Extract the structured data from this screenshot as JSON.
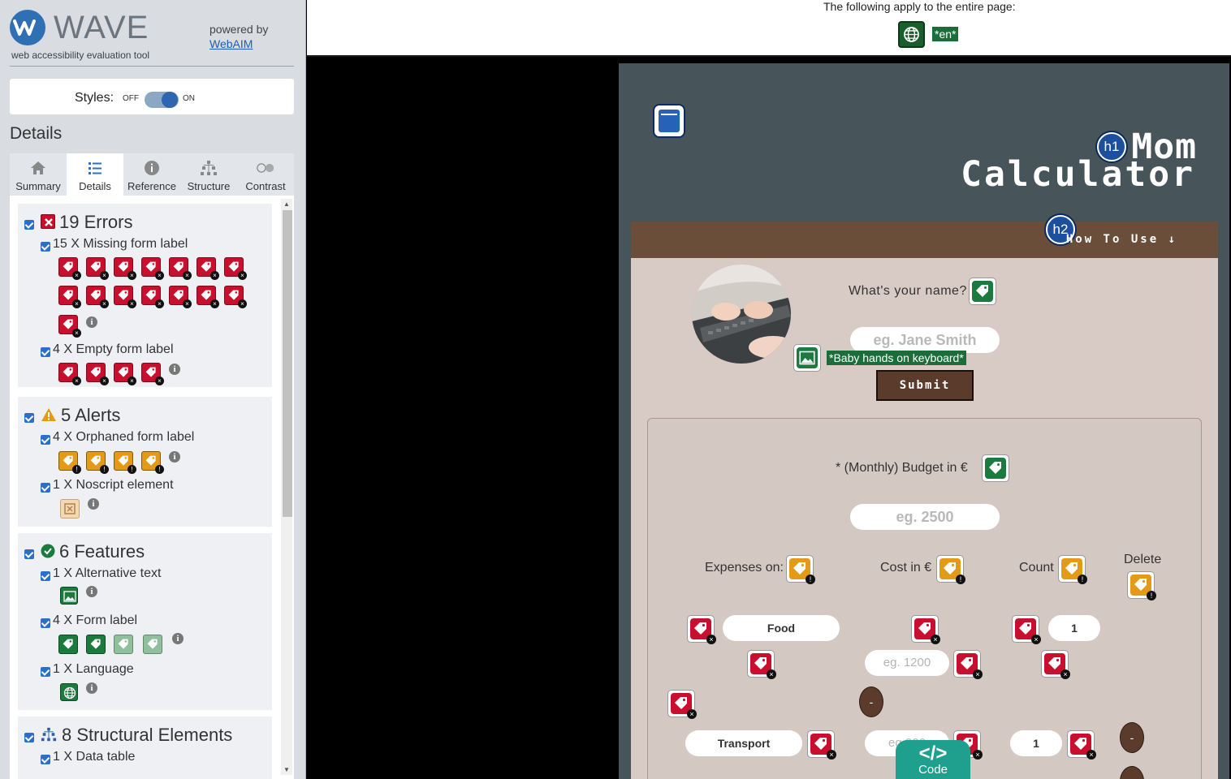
{
  "wave": {
    "brand": "WAVE",
    "subtitle": "web accessibility evaluation tool",
    "powered_by": "powered by",
    "webaim": "WebAIM",
    "styles_label": "Styles:",
    "toggle_off": "OFF",
    "toggle_on": "ON",
    "details_heading": "Details",
    "tabs": [
      {
        "label": "Summary",
        "icon": "home-icon"
      },
      {
        "label": "Details",
        "icon": "list-icon"
      },
      {
        "label": "Reference",
        "icon": "info-icon"
      },
      {
        "label": "Structure",
        "icon": "structure-icon"
      },
      {
        "label": "Contrast",
        "icon": "contrast-icon"
      }
    ],
    "errors": {
      "title": "19 Errors",
      "missing_label": "15 X Missing form label",
      "empty_label": "4 X Empty form label"
    },
    "alerts": {
      "title": "5 Alerts",
      "orphaned": "4 X Orphaned form label",
      "noscript": "1 X Noscript element"
    },
    "features": {
      "title": "6 Features",
      "alt_text": "1 X Alternative text",
      "form_label": "4 X Form label",
      "language": "1 X Language"
    },
    "structural": {
      "title": "8 Structural Elements",
      "data_table": "1 X Data table"
    },
    "info_glyph": "i"
  },
  "topbar": {
    "text": "The following apply to the entire page:",
    "lang_tag": "*en*"
  },
  "page": {
    "h1_badge": "h1",
    "h2_badge": "h2",
    "title_line1": "Mom",
    "title_line2": "Calculator",
    "how_to_use": "How To Use ↓",
    "name_label": "What's your name?",
    "name_placeholder": "eg. Jane Smith",
    "alt_text": "*Baby hands on keyboard*",
    "submit": "Submit",
    "budget_label": "* (Monthly) Budget in €",
    "budget_placeholder": "eg. 2500",
    "col_expenses": "Expenses on:",
    "col_cost": "Cost in €",
    "col_count": "Count",
    "col_delete": "Delete",
    "row1_expense": "Food",
    "row1_cost_placeholder": "eg. 1200",
    "row1_count": "1",
    "row2_expense": "Transport",
    "row2_cost_placeholder": "eg.200",
    "row2_count": "1",
    "delete_glyph": "-"
  },
  "code_button": {
    "symbol": "</>",
    "label": "Code"
  },
  "colors": {
    "error": "#c8102e",
    "alert": "#e39a17",
    "feature": "#1b7a3d",
    "page_bg": "#47555b",
    "accent_brown": "#5b3c2c"
  }
}
